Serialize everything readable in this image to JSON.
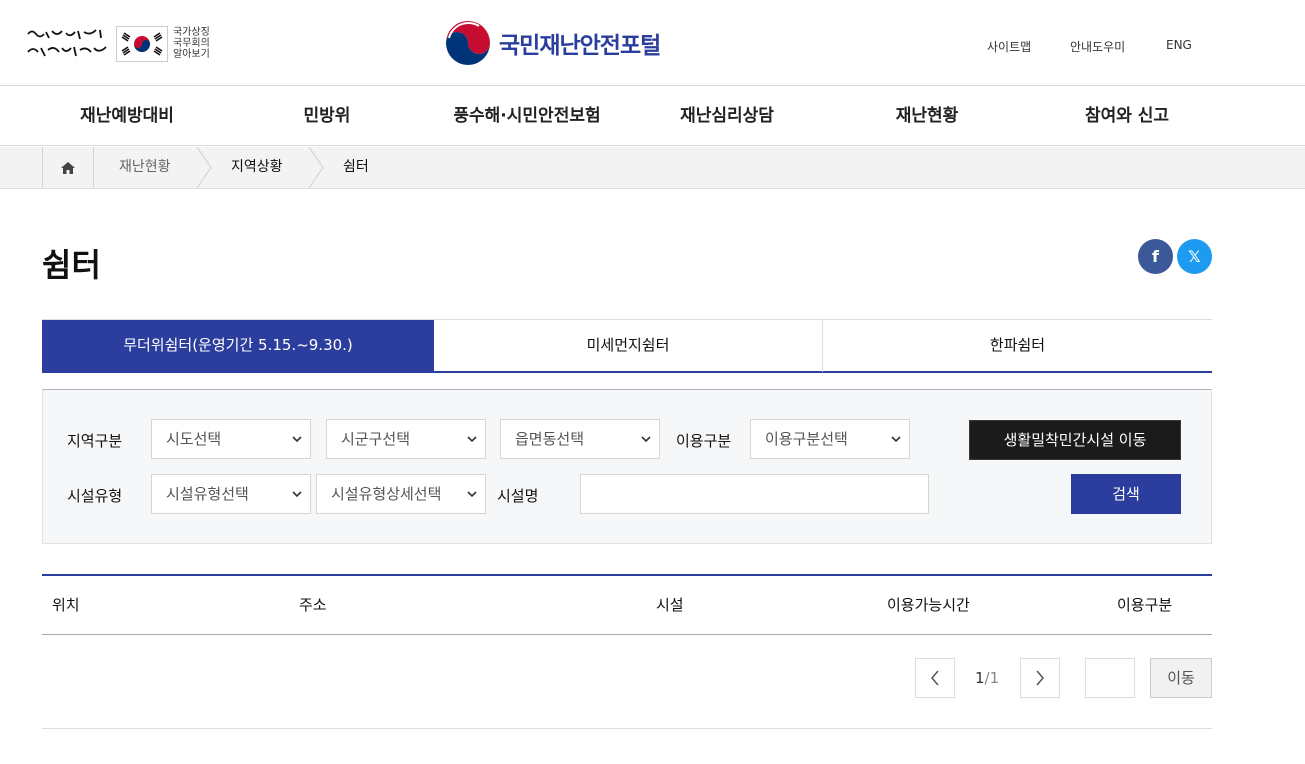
{
  "header": {
    "slogan_text": "다시 대한민국! 새로운 국민의 나라",
    "symbol_text_1": "국가상징",
    "symbol_text_2": "국무회의",
    "symbol_text_3": "알아보기",
    "brand": "국민재난안전포털",
    "util": [
      "사이트맵",
      "안내도우미",
      "ENG"
    ]
  },
  "gnb": [
    "재난예방대비",
    "민방위",
    "풍수해·시민안전보험",
    "재난심리상담",
    "재난현황",
    "참여와 신고"
  ],
  "breadcrumb": {
    "home_icon": "home-icon",
    "items": [
      "재난현황",
      "지역상황",
      "쉼터"
    ]
  },
  "page": {
    "title": "쉼터",
    "share": {
      "facebook": "f",
      "x": "𝕏"
    }
  },
  "tabs": [
    {
      "label": "무더위쉼터(운영기간 5.15.~9.30.)",
      "active": true
    },
    {
      "label": "미세먼지쉼터",
      "active": false
    },
    {
      "label": "한파쉼터",
      "active": false
    }
  ],
  "search": {
    "region_label": "지역구분",
    "sido": "시도선택",
    "sigungu": "시군구선택",
    "eupmyeondong": "읍면동선택",
    "usage_label": "이용구분",
    "usage": "이용구분선택",
    "facility_type_label": "시설유형",
    "facility_type": "시설유형선택",
    "facility_type_detail": "시설유형상세선택",
    "facility_name_label": "시설명",
    "facility_name_value": "",
    "private_btn": "생활밀착민간시설 이동",
    "search_btn": "검색"
  },
  "table": {
    "headers": [
      "위치",
      "주소",
      "시설",
      "이용가능시간",
      "이용구분"
    ]
  },
  "pagination": {
    "current": "1",
    "total": "/1",
    "go": "이동"
  },
  "colors": {
    "accent": "#2c3e9d",
    "facebook": "#3b5998",
    "x": "#1d9bf0"
  }
}
